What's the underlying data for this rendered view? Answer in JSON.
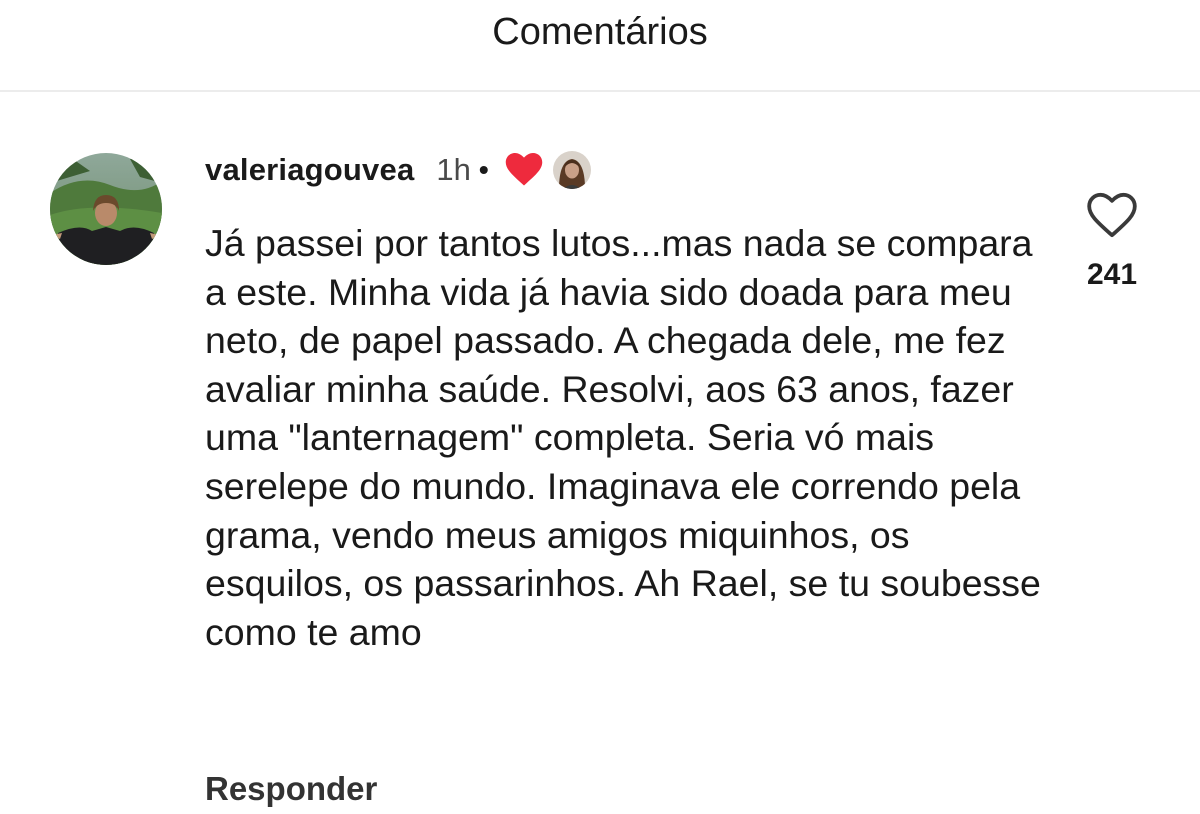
{
  "header": {
    "title": "Comentários"
  },
  "comment": {
    "username": "valeriagouvea",
    "time": "1h",
    "separator": "•",
    "text": "Já passei por tantos lutos...mas nada se compara a este. Minha vida já havia sido doada para meu neto, de papel passado. A chegada dele, me fez avaliar minha saúde. Resolvi, aos 63 anos, fazer uma \"lanternagem\" completa. Seria vó mais serelepe do mundo. Imaginava ele correndo pela grama, vendo meus amigos miquinhos, os esquilos, os passarinhos. Ah Rael, se tu soubesse como te amo",
    "reply_label": "Responder",
    "like_count": "241",
    "liked_by_author_icon": "heart-filled-icon",
    "like_icon": "heart-outline-icon"
  },
  "colors": {
    "liked_heart": "#ee2a3d",
    "text": "#1a1a1a",
    "divider": "#ececec"
  }
}
